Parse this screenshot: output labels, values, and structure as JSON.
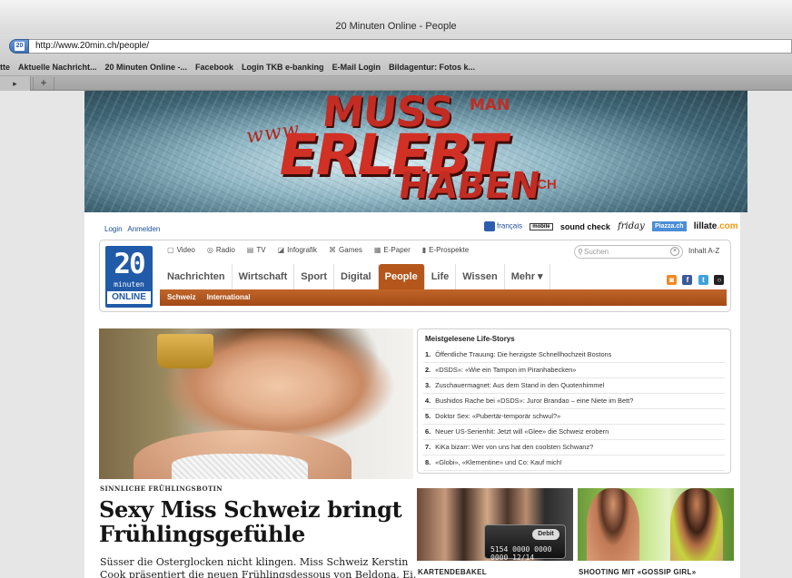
{
  "browser": {
    "window_title": "20 Minuten Online - People",
    "url": "http://www.20min.ch/people/",
    "bookmarks": [
      "tte",
      "Aktuelle Nachricht...",
      "20 Minuten Online -...",
      "Facebook",
      "Login TKB e-banking",
      "E-Mail Login",
      "Bildagentur: Fotos k..."
    ],
    "new_tab": "+"
  },
  "banner": {
    "www": "www.",
    "muss": "MUSS",
    "man": "MAN",
    "erlebt": "ERLEBT",
    "haben": "HABEN",
    "ch": ".CH"
  },
  "account": {
    "login": "Login",
    "register": "Anmelden"
  },
  "partners": {
    "francais": "français",
    "mobile": "mobile",
    "soundcheck": "sound check",
    "friday": "friday",
    "piazza": "Piazza.ch",
    "lilate": "lillate",
    "lilate_suffix": ".com"
  },
  "logo": {
    "number": "20",
    "minuten": "minuten",
    "online": "ONLINE"
  },
  "toplinks": [
    "Video",
    "Radio",
    "TV",
    "Infografik",
    "Games",
    "E-Paper",
    "E-Prospekte"
  ],
  "search": {
    "placeholder": "Suchen"
  },
  "index_link": "Inhalt A-Z",
  "mainnav": [
    "Nachrichten",
    "Wirtschaft",
    "Sport",
    "Digital",
    "People",
    "Life",
    "Wissen",
    "Mehr ▾"
  ],
  "mainnav_active": "People",
  "subnav": [
    "Schweiz",
    "International"
  ],
  "social": {
    "rss": "◙",
    "facebook": "f",
    "twitter": "t",
    "other": "○"
  },
  "article": {
    "kicker": "SINNLICHE FRÜHLINGSBOTIN",
    "headline": "Sexy Miss Schweiz bringt Frühlingsgefühle",
    "teaser": "Süsser die Osterglocken nicht klingen. Miss Schweiz Kerstin Cook präsentiert die neuen Frühlingsdessous von Beldona. Ei, ei, ei."
  },
  "mostread": {
    "title": "Meistgelesene Life-Storys",
    "items": [
      "Öffentliche Trauung: Die herzigste Schnellhochzeit Bostons",
      "«DSDS»: «Wie ein Tampon im Piranhabecken»",
      "Zuschauermagnet: Aus dem Stand in den Quotenhimmel",
      "Bushidos Rache bei «DSDS»: Juror Brandao – eine Niete im Bett?",
      "Doktor Sex: «Pubertär-temporär schwul?»",
      "Neuer US-Serienhit: Jetzt will «Glee» die Schweiz erobern",
      "KiKa bizarr: Wer von uns hat den coolsten Schwanz?",
      "«Globi», «Klementine» und Co: Kauf mich!"
    ]
  },
  "teasers": [
    {
      "label": "KARTENDEBAKEL",
      "card_badge": "Debit",
      "card_number": "5154 0000 0000 0000 12/14"
    },
    {
      "label": "SHOOTING MIT «GOSSIP GIRL»"
    }
  ],
  "colors": {
    "accent": "#b5571c",
    "logo_blue": "#215aa8",
    "link": "#1d4f9a"
  }
}
